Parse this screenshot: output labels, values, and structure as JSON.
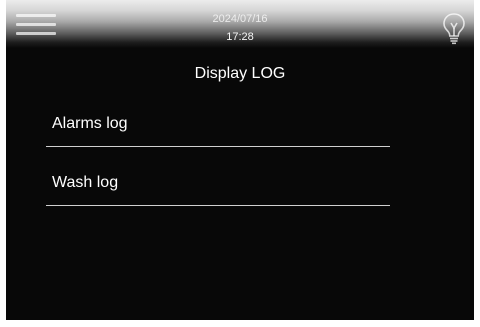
{
  "header": {
    "date": "2024/07/16",
    "time": "17:28",
    "menu_icon": "hamburger-menu-icon",
    "light_icon": "lightbulb-icon"
  },
  "page": {
    "title": "Display LOG"
  },
  "log_items": [
    {
      "label": "Alarms log"
    },
    {
      "label": "Wash log"
    }
  ],
  "colors": {
    "background": "#080808",
    "text": "#ffffff",
    "divider": "#cfcfcf"
  }
}
